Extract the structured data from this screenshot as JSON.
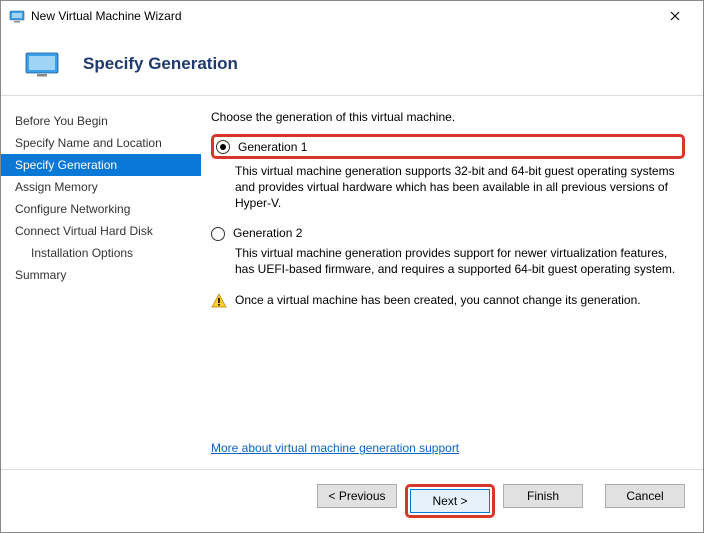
{
  "window": {
    "title": "New Virtual Machine Wizard"
  },
  "header": {
    "title": "Specify Generation"
  },
  "sidebar": {
    "items": [
      {
        "label": "Before You Begin"
      },
      {
        "label": "Specify Name and Location"
      },
      {
        "label": "Specify Generation"
      },
      {
        "label": "Assign Memory"
      },
      {
        "label": "Configure Networking"
      },
      {
        "label": "Connect Virtual Hard Disk"
      },
      {
        "label": "Installation Options"
      },
      {
        "label": "Summary"
      }
    ]
  },
  "content": {
    "intro": "Choose the generation of this virtual machine.",
    "gen1": {
      "label": "Generation 1",
      "desc": "This virtual machine generation supports 32-bit and 64-bit guest operating systems and provides virtual hardware which has been available in all previous versions of Hyper-V."
    },
    "gen2": {
      "label": "Generation 2",
      "desc": "This virtual machine generation provides support for newer virtualization features, has UEFI-based firmware, and requires a supported 64-bit guest operating system."
    },
    "warning": "Once a virtual machine has been created, you cannot change its generation.",
    "link": "More about virtual machine generation support"
  },
  "footer": {
    "previous": "< Previous",
    "next": "Next >",
    "finish": "Finish",
    "cancel": "Cancel"
  }
}
